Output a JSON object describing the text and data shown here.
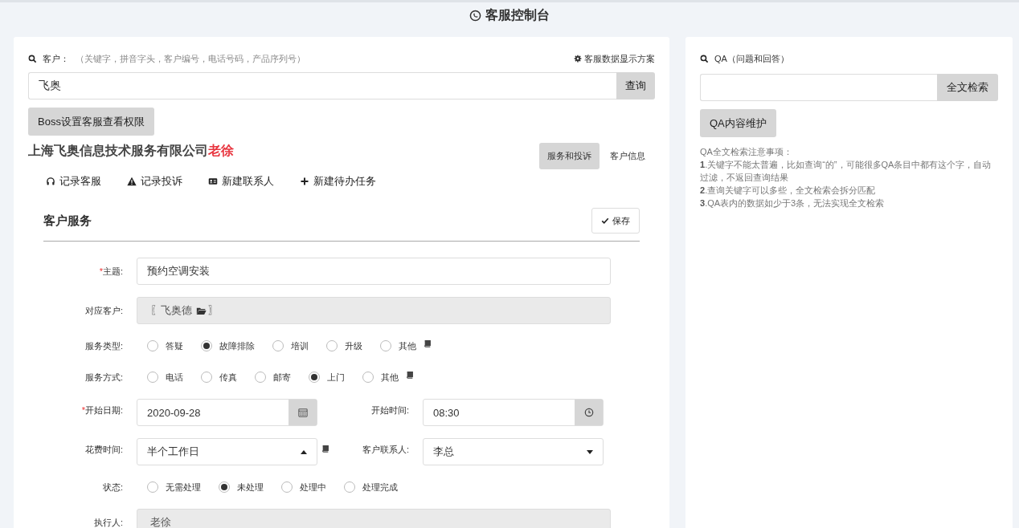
{
  "header": {
    "title": "客服控制台"
  },
  "customer_panel": {
    "search_label": "客户：",
    "search_hint": "（关键字，拼音字头，客户编号，电话号码，产品序列号）",
    "settings_link": "客服数据显示方案",
    "search_value": "飞奥",
    "search_button": "查询",
    "boss_button": "Boss设置客服查看权限",
    "company": "上海飞奥信息技术服务有限公司",
    "contact": "老徐",
    "tabs": [
      {
        "label": "服务和投诉",
        "selected": true
      },
      {
        "label": "客户信息",
        "selected": false
      }
    ],
    "actions": [
      {
        "kind": "headset",
        "label": "记录客服"
      },
      {
        "kind": "warning",
        "label": "记录投诉"
      },
      {
        "kind": "card",
        "label": "新建联系人"
      },
      {
        "kind": "plus",
        "label": "新建待办任务"
      }
    ],
    "section_title": "客户服务",
    "save_button": "保存",
    "rows": [
      {
        "kind": "input",
        "required_mark": "*",
        "label": "主题:",
        "value": "预约空调安装"
      },
      {
        "kind": "readonly",
        "label": "对应客户:",
        "value": "〖飞奥德",
        "value_end": "〗"
      },
      {
        "kind": "radio",
        "label": "服务类型:",
        "note_icon": true,
        "options": [
          {
            "label": "答疑",
            "selected": false
          },
          {
            "label": "故障排除",
            "selected": true
          },
          {
            "label": "培训",
            "selected": false
          },
          {
            "label": "升级",
            "selected": false
          },
          {
            "label": "其他",
            "selected": false
          }
        ]
      },
      {
        "kind": "radio",
        "label": "服务方式:",
        "note_icon": true,
        "options": [
          {
            "label": "电话",
            "selected": false
          },
          {
            "label": "传真",
            "selected": false
          },
          {
            "label": "邮寄",
            "selected": false
          },
          {
            "label": "上门",
            "selected": true
          },
          {
            "label": "其他",
            "selected": false
          }
        ]
      },
      {
        "kind": "pair",
        "fields": [
          {
            "kind": "date",
            "required_mark": "*",
            "label": "开始日期:",
            "value": "2020-09-28"
          },
          {
            "kind": "time",
            "label": "开始时间:",
            "value": "08:30"
          }
        ]
      },
      {
        "kind": "pair",
        "fields": [
          {
            "kind": "select",
            "label": "花费时间:",
            "value": "半个工作日",
            "caret_up": true,
            "note_icon": true
          },
          {
            "kind": "select",
            "label": "客户联系人:",
            "value": "李总",
            "caret_up": false
          }
        ]
      },
      {
        "kind": "radio",
        "label": "状态:",
        "options": [
          {
            "label": "无需处理",
            "selected": false
          },
          {
            "label": "未处理",
            "selected": true
          },
          {
            "label": "处理中",
            "selected": false
          },
          {
            "label": "处理完成",
            "selected": false
          }
        ]
      },
      {
        "kind": "readonly",
        "label": "执行人:",
        "value": "老徐"
      }
    ]
  },
  "qa_panel": {
    "title": "QA（问题和回答）",
    "search_button": "全文检索",
    "maintain_button": "QA内容维护",
    "notes_title": "QA全文检索注意事项：",
    "notes": [
      "**1**.关键字不能太普遍，比如查询“的”，可能很多QA条目中都有这个字，自动过滤，不返回查询结果",
      "**2**.查询关键字可以多些，全文检索会拆分匹配",
      "**3**.QA表内的数据如少于3条，无法实现全文检索"
    ]
  }
}
